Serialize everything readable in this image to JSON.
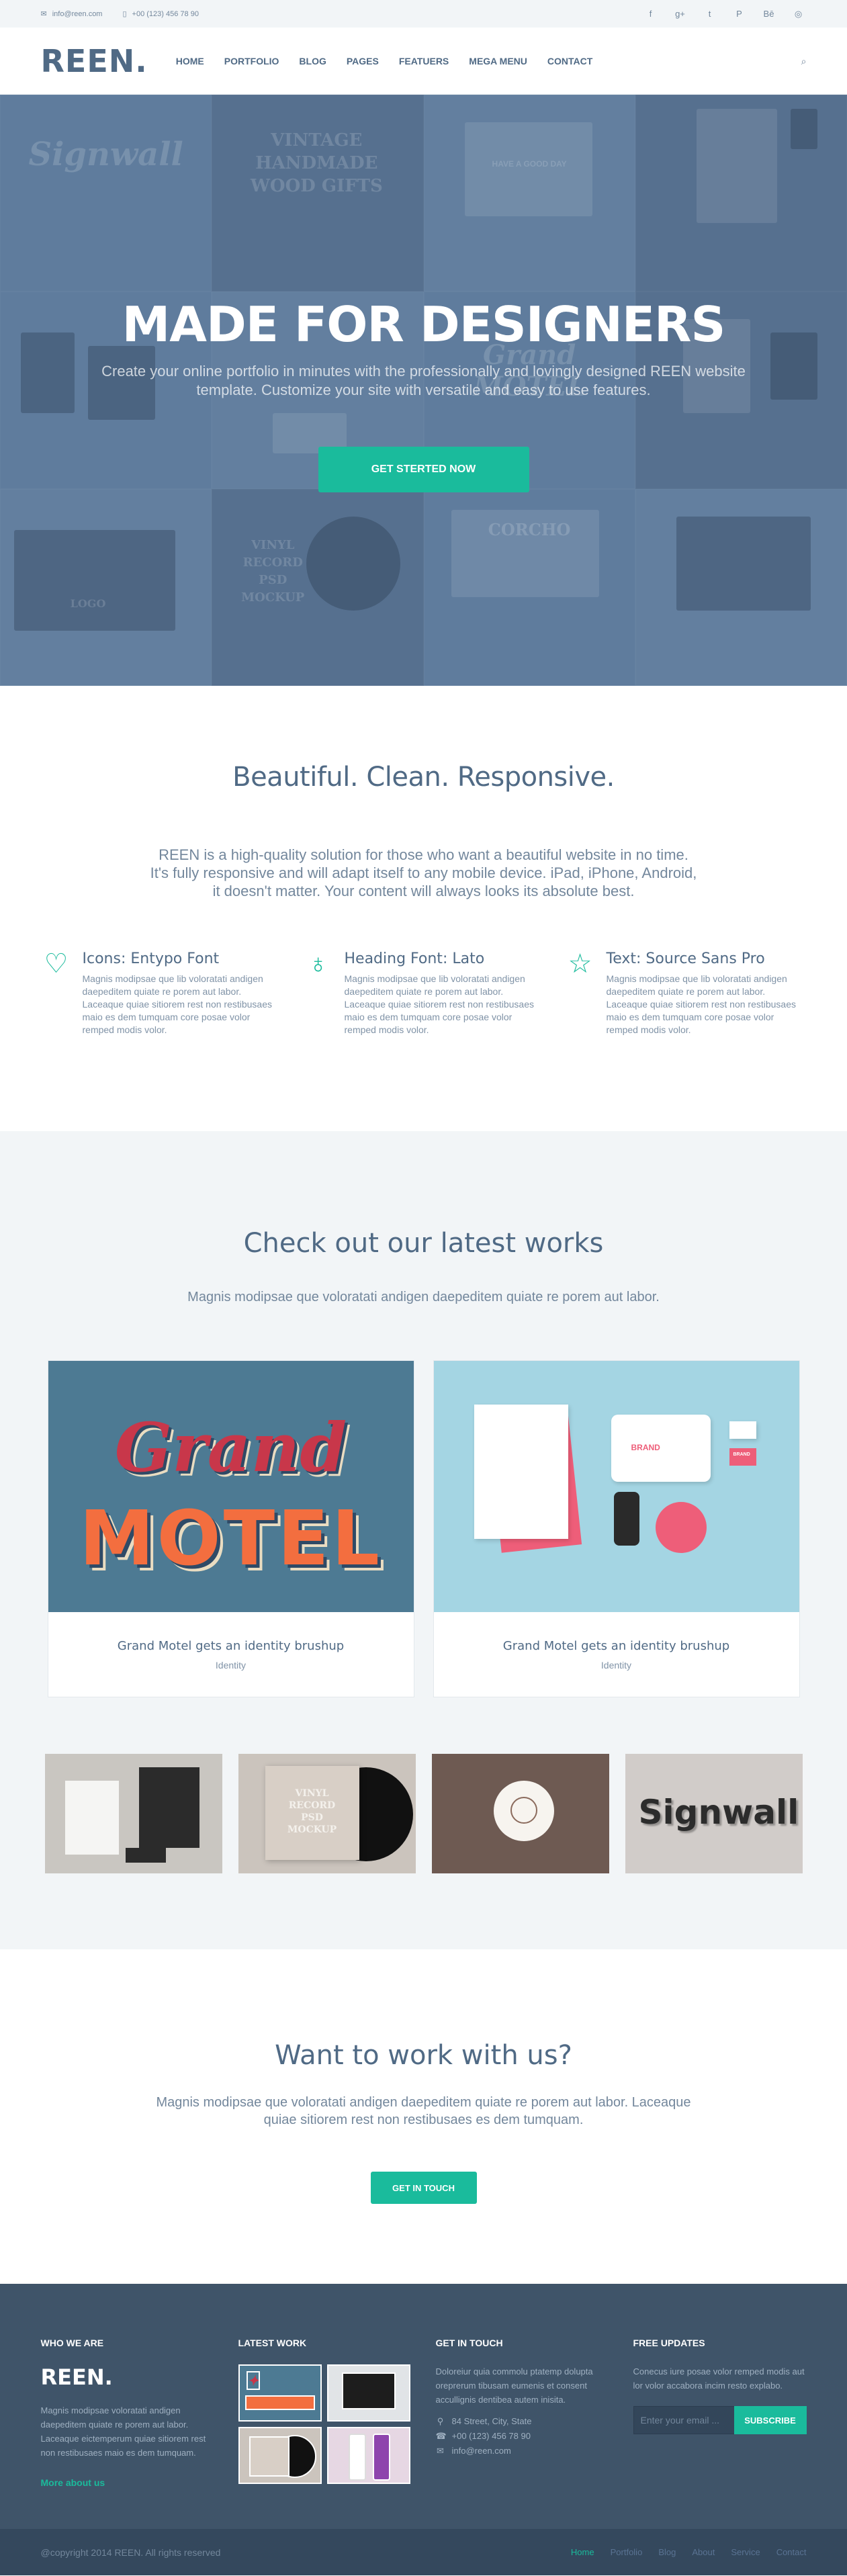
{
  "topbar": {
    "email": "info@reen.com",
    "phone": "+00 (123) 456 78 90",
    "socials": [
      {
        "name": "facebook-icon",
        "glyph": "f"
      },
      {
        "name": "google-plus-icon",
        "glyph": "g+"
      },
      {
        "name": "twitter-icon",
        "glyph": "t"
      },
      {
        "name": "pinterest-icon",
        "glyph": "P"
      },
      {
        "name": "behance-icon",
        "glyph": "Bē"
      },
      {
        "name": "dribbble-icon",
        "glyph": "◎"
      }
    ]
  },
  "header": {
    "logo": "REEN.",
    "nav": [
      "HOME",
      "PORTFOLIO",
      "BLOG",
      "PAGES",
      "FEATUERS",
      "MEGA MENU",
      "CONTACT"
    ]
  },
  "hero": {
    "title": "MADE FOR DESIGNERS",
    "subtitle": "Create your online portfolio in minutes with the professionally and lovingly designed REEN website template. Customize your site with versatile and easy to use features.",
    "button": "GET STERTED NOW",
    "tile_words": [
      "Signwall",
      "VINTAGE HANDMADE WOOD GIFTS",
      "HAVE A GOOD DAY",
      "Grand MOTEL",
      "LOGO",
      "VINYL RECORD PSD MOCKUP",
      "CORCHO"
    ]
  },
  "intro": {
    "title": "Beautiful. Clean. Responsive.",
    "lead": "REEN is a high-quality solution for those who want a beautiful website in no time. It's fully responsive and will adapt itself to any mobile device. iPad, iPhone, Android, it doesn't matter. Your content will always looks its absolute best.",
    "features": [
      {
        "icon": "heart-icon",
        "glyph": "♡",
        "title": "Icons: Entypo Font",
        "text": "Magnis modipsae que lib voloratati andigen daepeditem quiate re porem aut labor. Laceaque quiae sitiorem rest non restibusaes maio es dem tumquam core posae volor remped modis volor."
      },
      {
        "icon": "lightbulb-icon",
        "glyph": "♁",
        "title": "Heading Font: Lato",
        "text": "Magnis modipsae que lib voloratati andigen daepeditem quiate re porem aut labor. Laceaque quiae sitiorem rest non restibusaes maio es dem tumquam core posae volor remped modis volor."
      },
      {
        "icon": "star-icon",
        "glyph": "☆",
        "title": "Text: Source Sans Pro",
        "text": "Magnis modipsae que lib voloratati andigen daepeditem quiate re porem aut labor. Laceaque quiae sitiorem rest non restibusaes maio es dem tumquam core posae volor remped modis volor."
      }
    ]
  },
  "works": {
    "title": "Check out our latest works",
    "lead": "Magnis modipsae que voloratati andigen daepeditem quiate re porem aut labor.",
    "cards": [
      {
        "title": "Grand Motel gets an identity brushup",
        "tag": "Identity",
        "art1": "Grand",
        "art2": "MOTEL"
      },
      {
        "title": "Grand Motel gets an identity brushup",
        "tag": "Identity",
        "art1": "BRAND",
        "art2": "BRAND"
      }
    ],
    "small_words": [
      "",
      "VINYL RECORD PSD MOCKUP",
      "",
      "Signwall"
    ]
  },
  "cta": {
    "title": "Want to work with us?",
    "lead": "Magnis modipsae que voloratati andigen daepeditem quiate re porem aut labor. Laceaque quiae sitiorem rest non restibusaes es dem tumquam.",
    "button": "GET IN TOUCH"
  },
  "footer": {
    "who": {
      "heading": "WHO WE ARE",
      "logo": "REEN.",
      "text": "Magnis modipsae voloratati andigen daepeditem quiate re porem aut labor. Laceaque eictemperum quiae sitiorem rest non restibusaes maio es dem tumquam.",
      "more": "More about us"
    },
    "latest": {
      "heading": "LATEST WORK"
    },
    "touch": {
      "heading": "GET IN TOUCH",
      "text": "Doloreiur quia commolu ptatemp dolupta oreprerum tibusam eumenis et consent accullignis dentibea autem inisita.",
      "address": "84 Street, City, State",
      "phone": "+00 (123) 456 78 90",
      "email": "info@reen.com"
    },
    "updates": {
      "heading": "FREE UPDATES",
      "text": "Conecus iure posae volor remped modis aut lor volor accabora incim resto explabo.",
      "placeholder": "Enter your email ...",
      "button": "SUBSCRIBE"
    }
  },
  "bottombar": {
    "copyright": "@copyright 2014 REEN. All rights reserved",
    "nav": [
      "Home",
      "Portfolio",
      "Blog",
      "About",
      "Service",
      "Contact"
    ]
  },
  "colors": {
    "accent": "#1abb9c",
    "heading": "#506a85",
    "text": "#73879c",
    "footer": "#3f5469"
  }
}
